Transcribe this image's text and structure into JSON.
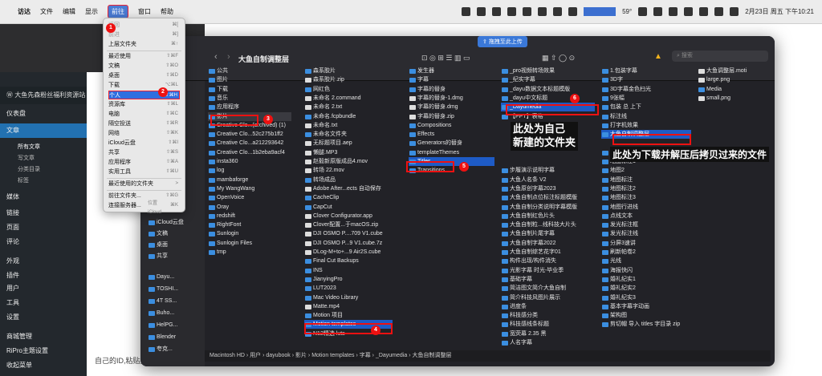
{
  "menubar": {
    "items": [
      "访达",
      "文件",
      "编辑",
      "显示",
      "前往",
      "窗口",
      "帮助"
    ],
    "battery": "59°",
    "datetime": "2月23日 周五 下午10:21"
  },
  "finder": {
    "title": "大鱼自制调整层",
    "search_placeholder": "搜索",
    "upload_button": "拖拽至此上传",
    "sidebar": [
      "公共",
      "图片",
      "下载",
      "音乐",
      "应用程序",
      "影片",
      "Creative Clo...(archived) (1)",
      "Creative Clo...52c275b1ff2",
      "Creative Clo...a212293642",
      "Creative Clo...1b2eba9acf4",
      "insta360",
      "log",
      "mambaforge",
      "My WangWang",
      "OpenVoice",
      "Oray",
      "redshift",
      "RightFont",
      "Sunlogin",
      "Sunlogin Files",
      "tmp"
    ],
    "icloud_header": "iCloud",
    "icloud_items": [
      "iCloud云盘",
      "文稿",
      "桌面",
      "共享"
    ],
    "locations_header": "位置",
    "locations": [
      "Dayu...",
      "TOSHI...",
      "4T SS...",
      "Buho...",
      "HelPG...",
      "Blender",
      "夸克..."
    ],
    "col1": [
      "森系胶片",
      "森系胶片.zip",
      "网红色",
      "未命名 2.command",
      "未命名 2.txt",
      "未命名.fcpbundle",
      "未命名.txt",
      "未命名文件夹",
      "无标题项目.aep",
      "懒腿.MP3",
      "赵毅新原版成品4.mov",
      "转场 22.mov",
      "转场成品",
      "Adobe After...ects 自动保存",
      "CacheClip",
      "CapCut",
      "Clover Configurator.app",
      "Clover配置...于macOS.zip",
      "DJI OSMO P....709 V1.cube",
      "DJI OSMO P...9 V1.cube.7z",
      "DLog-M+to+...9 Air2S.cube",
      "Final Cut Backups",
      "INS",
      "JianyingPro",
      "LUT2023",
      "Mac Video Library",
      "Matte.mp4",
      "Motion 项目",
      "Motion templates",
      "N12精选 luts"
    ],
    "col2": [
      "发生器",
      "字幕",
      "字幕的替身",
      "字幕的替身-1.dmg",
      "字幕的替身.dmg",
      "字幕的替身.zip",
      "Compositions",
      "Effects",
      "Generators的替身",
      "templateThemes",
      "Titles",
      "Transitions"
    ],
    "col3": [
      "_pro视频转场效果",
      "_纪实字幕",
      "_dayu数据文本标题模版",
      "_dayu中文标题",
      "_Dayumedia",
      "【PPT】表格",
      "",
      "",
      "",
      "",
      "",
      "步履演示说明字幕",
      "大鱼人名条 V2",
      "大鱼原创字幕2023",
      "大鱼自制点位标注标题模版",
      "大鱼自制分类说明字幕模版",
      "大鱼自制红色片头",
      "大鱼自制粒...线科技大片头",
      "大鱼自制片尾字幕",
      "大鱼自制字幕2022",
      "大鱼自制综艺花字01",
      "构件出现/构件消失",
      "光影字幕 时光-毕业季",
      "基础字幕",
      "简洁图文简介大鱼自制",
      "简介科技风图片展示",
      "进度条",
      "科技感分类",
      "科技感线条标题",
      "宽荧幕 2.35 黑",
      "人名字幕"
    ],
    "col4": [
      "1.包装字幕",
      "3D字",
      "3D字幕金色扫光",
      "9张幅",
      "包装 总 上下",
      "标注线",
      "打字机效果",
      "大鱼自制调整层",
      "",
      "充满图书馆1",
      "地图标注1",
      "地图2",
      "地图标注",
      "地图标注2",
      "地图标注3",
      "地图行进线",
      "点线文本",
      "发光标注框",
      "发光标注线",
      "分屏3速讲",
      "刷新帕卷2",
      "光线",
      "海报快闪",
      "婚礼纪实1",
      "婚礼纪实2",
      "婚礼纪实3",
      "基本字幕字动画",
      "架构图",
      "剪切帽 导入 titles 字目录 zip"
    ],
    "col5": [
      "大鱼调整层.moti",
      "large.png",
      "Media",
      "small.png"
    ],
    "path": "Macintosh HD › 用户 › dayubook › 影片 › Motion templates › 字幕 › _Dayumedia › 大鱼自制调整层"
  },
  "gomenu": {
    "items": [
      {
        "label": "返回",
        "sc": "⌘[",
        "dis": true
      },
      {
        "label": "前进",
        "sc": "⌘]",
        "dis": true
      },
      {
        "label": "上层文件夹",
        "sc": "⌘↑"
      },
      {
        "label": "最近使用",
        "sc": "⇧⌘F"
      },
      {
        "label": "文稿",
        "sc": "⇧⌘O"
      },
      {
        "label": "桌面",
        "sc": "⇧⌘D"
      },
      {
        "label": "下载",
        "sc": "⌥⌘L"
      },
      {
        "label": "个人",
        "sc": "⇧⌘H"
      },
      {
        "label": "资源库",
        "sc": "⇧⌘L"
      },
      {
        "label": "电脑",
        "sc": "⇧⌘C"
      },
      {
        "label": "隔空投送",
        "sc": "⇧⌘R"
      },
      {
        "label": "网络",
        "sc": "⇧⌘K"
      },
      {
        "label": "iCloud云盘",
        "sc": "⇧⌘I"
      },
      {
        "label": "共享",
        "sc": "⇧⌘S"
      },
      {
        "label": "应用程序",
        "sc": "⇧⌘A"
      },
      {
        "label": "实用工具",
        "sc": "⇧⌘U"
      },
      {
        "label": "最近使用的文件夹",
        "sc": ">"
      },
      {
        "label": "前往文件夹...",
        "sc": "⇧⌘G"
      },
      {
        "label": "连接服务器...",
        "sc": "⌘K"
      }
    ]
  },
  "wp": {
    "site": "大鱼先森粉丝福利资源站",
    "items": [
      "仪表盘",
      "文章",
      "所有文章",
      "写文章",
      "分类目录",
      "标签",
      "媒体",
      "链接",
      "页面",
      "评论",
      "外观",
      "插件",
      "用户",
      "工具",
      "设置",
      "商城管理",
      "RiPro主题设置",
      "收起菜单"
    ],
    "doc_line": "自己的ID,粘贴文件夹的拷贝过去……"
  },
  "annotations": {
    "own_folder": "此处为自己\n新建的文件夹",
    "copied": "此处为下载并解压后拷贝过来的文件",
    "badges": [
      "1",
      "2",
      "3",
      "4",
      "5",
      "6"
    ]
  }
}
